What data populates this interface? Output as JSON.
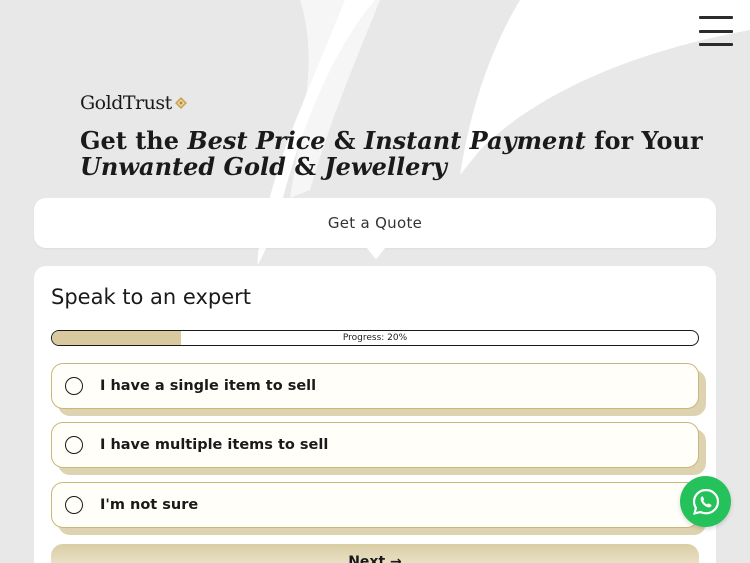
{
  "header": {
    "logo_text": "GoldTrust",
    "menu_icon": "hamburger-menu-icon"
  },
  "hero": {
    "line1_pre": "Get the ",
    "line1_bold1": "Best Price",
    "line1_mid": " & ",
    "line1_bold2": "Instant Payment",
    "line1_post": " for Your",
    "line2_bold1": "Unwanted Gold",
    "line2_mid": " & ",
    "line2_bold2": "Jewellery"
  },
  "quote_tab": {
    "label": "Get a Quote"
  },
  "form": {
    "title": "Speak to an expert",
    "progress": {
      "label": "Progress: 20%",
      "value": 0.2
    },
    "options": [
      {
        "label": "I have a single item to sell"
      },
      {
        "label": "I have multiple items to sell"
      },
      {
        "label": "I'm not sure"
      }
    ],
    "next_label": "Next →"
  },
  "floating": {
    "whatsapp_icon": "whatsapp-icon"
  },
  "colors": {
    "accent_gold": "#d8c99e",
    "option_border": "#c9b77a",
    "whatsapp_green": "#25c15b",
    "background": "#e8e8e8"
  }
}
